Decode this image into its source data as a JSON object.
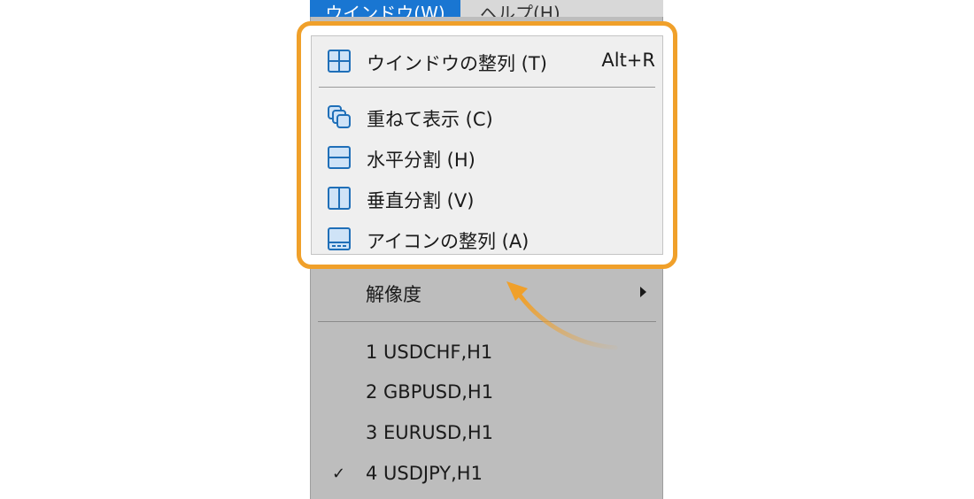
{
  "menubar": {
    "window_label": "ウインドウ(W)",
    "help_label": "ヘルプ(H)"
  },
  "highlight_menu": {
    "tile": {
      "label": "ウインドウの整列 (T)",
      "shortcut": "Alt+R",
      "icon": "tile-windows-icon"
    },
    "cascade": {
      "label": "重ねて表示 (C)",
      "icon": "cascade-windows-icon"
    },
    "horizontal": {
      "label": "水平分割 (H)",
      "icon": "tile-horizontal-icon"
    },
    "vertical": {
      "label": "垂直分割 (V)",
      "icon": "tile-vertical-icon"
    },
    "arrange_icons": {
      "label": "アイコンの整列 (A)",
      "icon": "arrange-icons-icon"
    }
  },
  "menu": {
    "resolution": {
      "label": "解像度"
    },
    "windows": [
      {
        "label": "1 USDCHF,H1",
        "checked": false
      },
      {
        "label": "2 GBPUSD,H1",
        "checked": false
      },
      {
        "label": "3 EURUSD,H1",
        "checked": false
      },
      {
        "label": "4 USDJPY,H1",
        "checked": true
      }
    ],
    "check_mark": "✓"
  },
  "colors": {
    "highlight_border": "#f0a02a",
    "icon_blue": "#1f6fb8",
    "icon_fill": "#cfe3f7",
    "menubar_active": "#1976d2",
    "dropdown_bg": "#bdbdbd"
  }
}
